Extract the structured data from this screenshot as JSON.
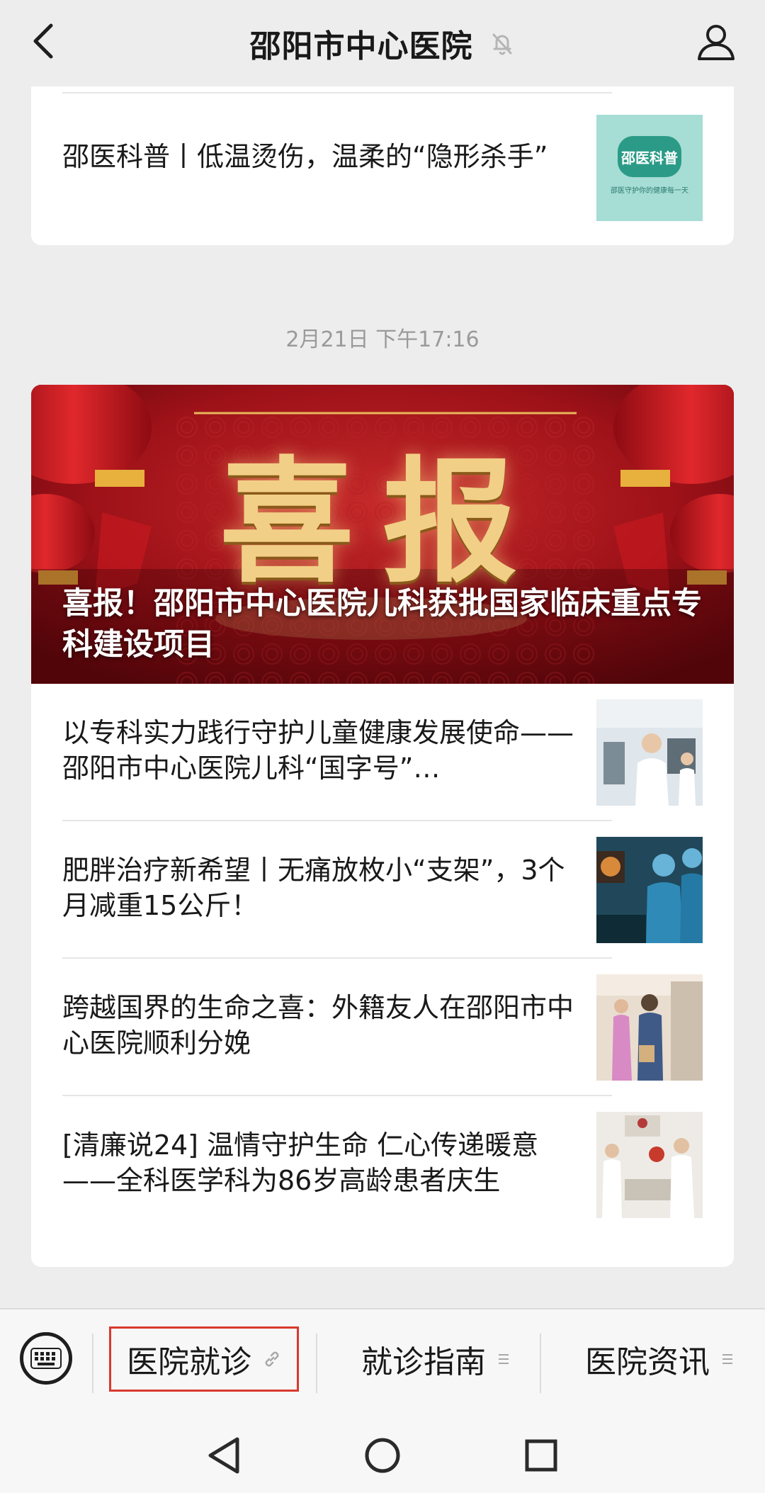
{
  "header": {
    "title": "邵阳市中心医院",
    "back_icon": "chevron-left-icon",
    "mute_icon": "bell-off-icon",
    "profile_icon": "user-icon"
  },
  "top_card": {
    "article": {
      "title": "邵医科普丨低温烫伤，温柔的“隐形杀手”",
      "thumb_text_main": "邵医科普",
      "thumb_text_sub": "邵医守护你的健康每一天"
    }
  },
  "timestamp": "2月21日 下午17:16",
  "main_card": {
    "banner": {
      "title": "喜报！邵阳市中心医院儿科获批国家临床重点专科建设项目",
      "image_text": "喜报"
    },
    "articles": [
      {
        "title": "以专科实力践行守护儿童健康发展使命——邵阳市中心医院儿科“国字号”…"
      },
      {
        "title": "肥胖治疗新希望丨无痛放枚小“支架”，3个月减重15公斤！"
      },
      {
        "title": "跨越国界的生命之喜：外籍友人在邵阳市中心医院顺利分娩"
      },
      {
        "title": "[清廉说24] 温情守护生命 仁心传递暖意——全科医学科为86岁高龄患者庆生"
      }
    ]
  },
  "menu": {
    "keyboard_icon": "keyboard-icon",
    "items": [
      {
        "label": "医院就诊",
        "icon": "link-icon"
      },
      {
        "label": "就诊指南",
        "icon": "menu-lines-icon"
      },
      {
        "label": "医院资讯",
        "icon": "menu-lines-icon"
      }
    ]
  },
  "navbar": {
    "back_icon": "triangle-back-icon",
    "home_icon": "circle-home-icon",
    "recents_icon": "square-recents-icon"
  },
  "colors": {
    "background": "#ededed",
    "highlight": "#d9392e",
    "banner_red": "#a3131a"
  }
}
